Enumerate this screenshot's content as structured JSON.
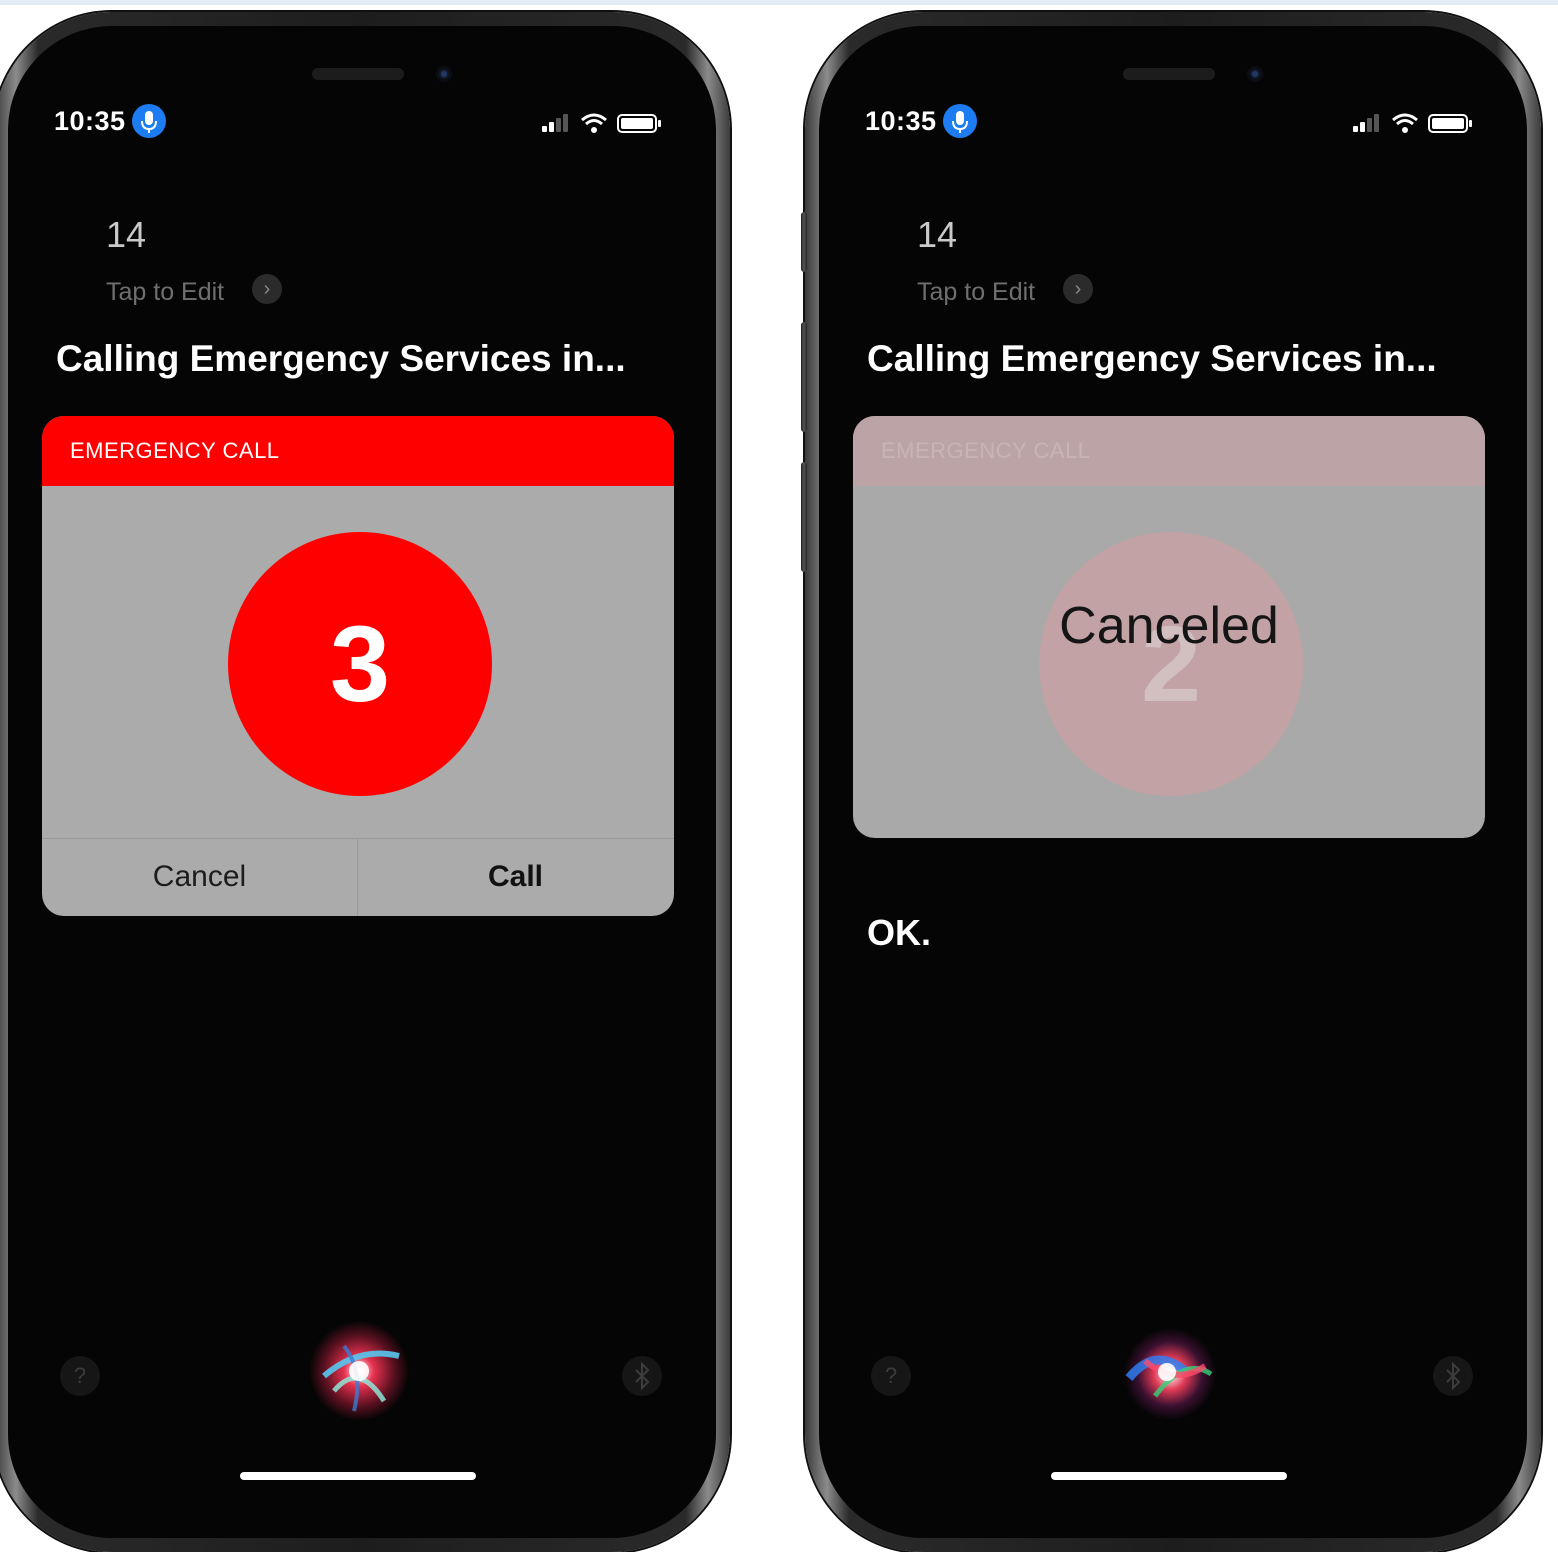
{
  "left_phone": {
    "status": {
      "time": "10:35"
    },
    "query": "14",
    "tap_to_edit": "Tap to Edit",
    "headline": "Calling Emergency Services in...",
    "card": {
      "header": "EMERGENCY CALL",
      "countdown": "3",
      "cancel_label": "Cancel",
      "call_label": "Call"
    }
  },
  "right_phone": {
    "status": {
      "time": "10:35"
    },
    "query": "14",
    "tap_to_edit": "Tap to Edit",
    "headline": "Calling Emergency Services in...",
    "card": {
      "header": "EMERGENCY CALL",
      "countdown": "2",
      "state_label": "Canceled"
    },
    "response": "OK."
  },
  "icons": {
    "mic": "microphone-icon",
    "signal": "cellular-signal-icon",
    "wifi": "wifi-icon",
    "battery": "battery-icon",
    "chevron": "chevron-right-icon",
    "help": "question-mark-icon",
    "bluetooth": "bluetooth-icon",
    "siri": "siri-orb-icon"
  },
  "colors": {
    "emergency_red": "#ff0000",
    "card_gray": "#ababab",
    "mic_blue": "#1e7cf2",
    "screen_bg": "#050505"
  }
}
